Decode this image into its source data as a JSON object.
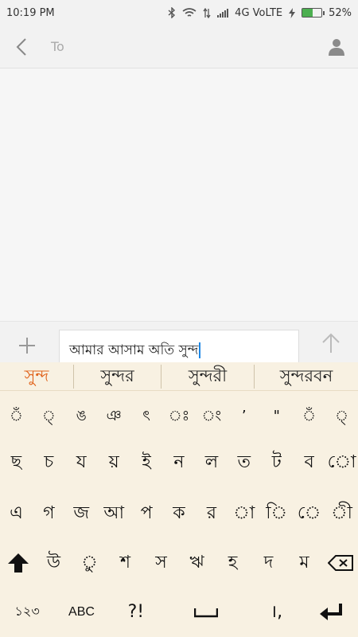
{
  "status": {
    "time": "10:19 PM",
    "network": "4G VoLTE",
    "battery": "52%",
    "battery_level": 0.52
  },
  "appbar": {
    "to_placeholder": "To"
  },
  "compose": {
    "message_text": "আমার আসাম অতি সুন্দ"
  },
  "suggestions": [
    "সুন্দ",
    "সুন্দর",
    "সুন্দরী",
    "সুন্দরবন"
  ],
  "keyboard": {
    "row1": [
      "ঁ",
      "্",
      "ঙ",
      "ঞ",
      "ৎ",
      "ঃ",
      "ং",
      "’",
      "\"",
      "ঁ",
      "্"
    ],
    "row2": [
      "ছ",
      "চ",
      "য",
      "য়",
      "ই",
      "ন",
      "ল",
      "ত",
      "ট",
      "ব",
      "ো"
    ],
    "row3": [
      "এ",
      "গ",
      "জ",
      "আ",
      "প",
      "ক",
      "র",
      "া",
      "ি",
      "ে",
      "ী"
    ],
    "row4": [
      "উ",
      "ু",
      "শ",
      "স",
      "ঋ",
      "হ",
      "দ",
      "ম"
    ],
    "bottom": {
      "numbers": "১২৩",
      "abc": "ABC",
      "symbols": "?!",
      "punct": "।,"
    }
  },
  "colors": {
    "accent": "#e0621a",
    "caret": "#1e88e5",
    "keyboard_bg": "#f8f1e2"
  }
}
